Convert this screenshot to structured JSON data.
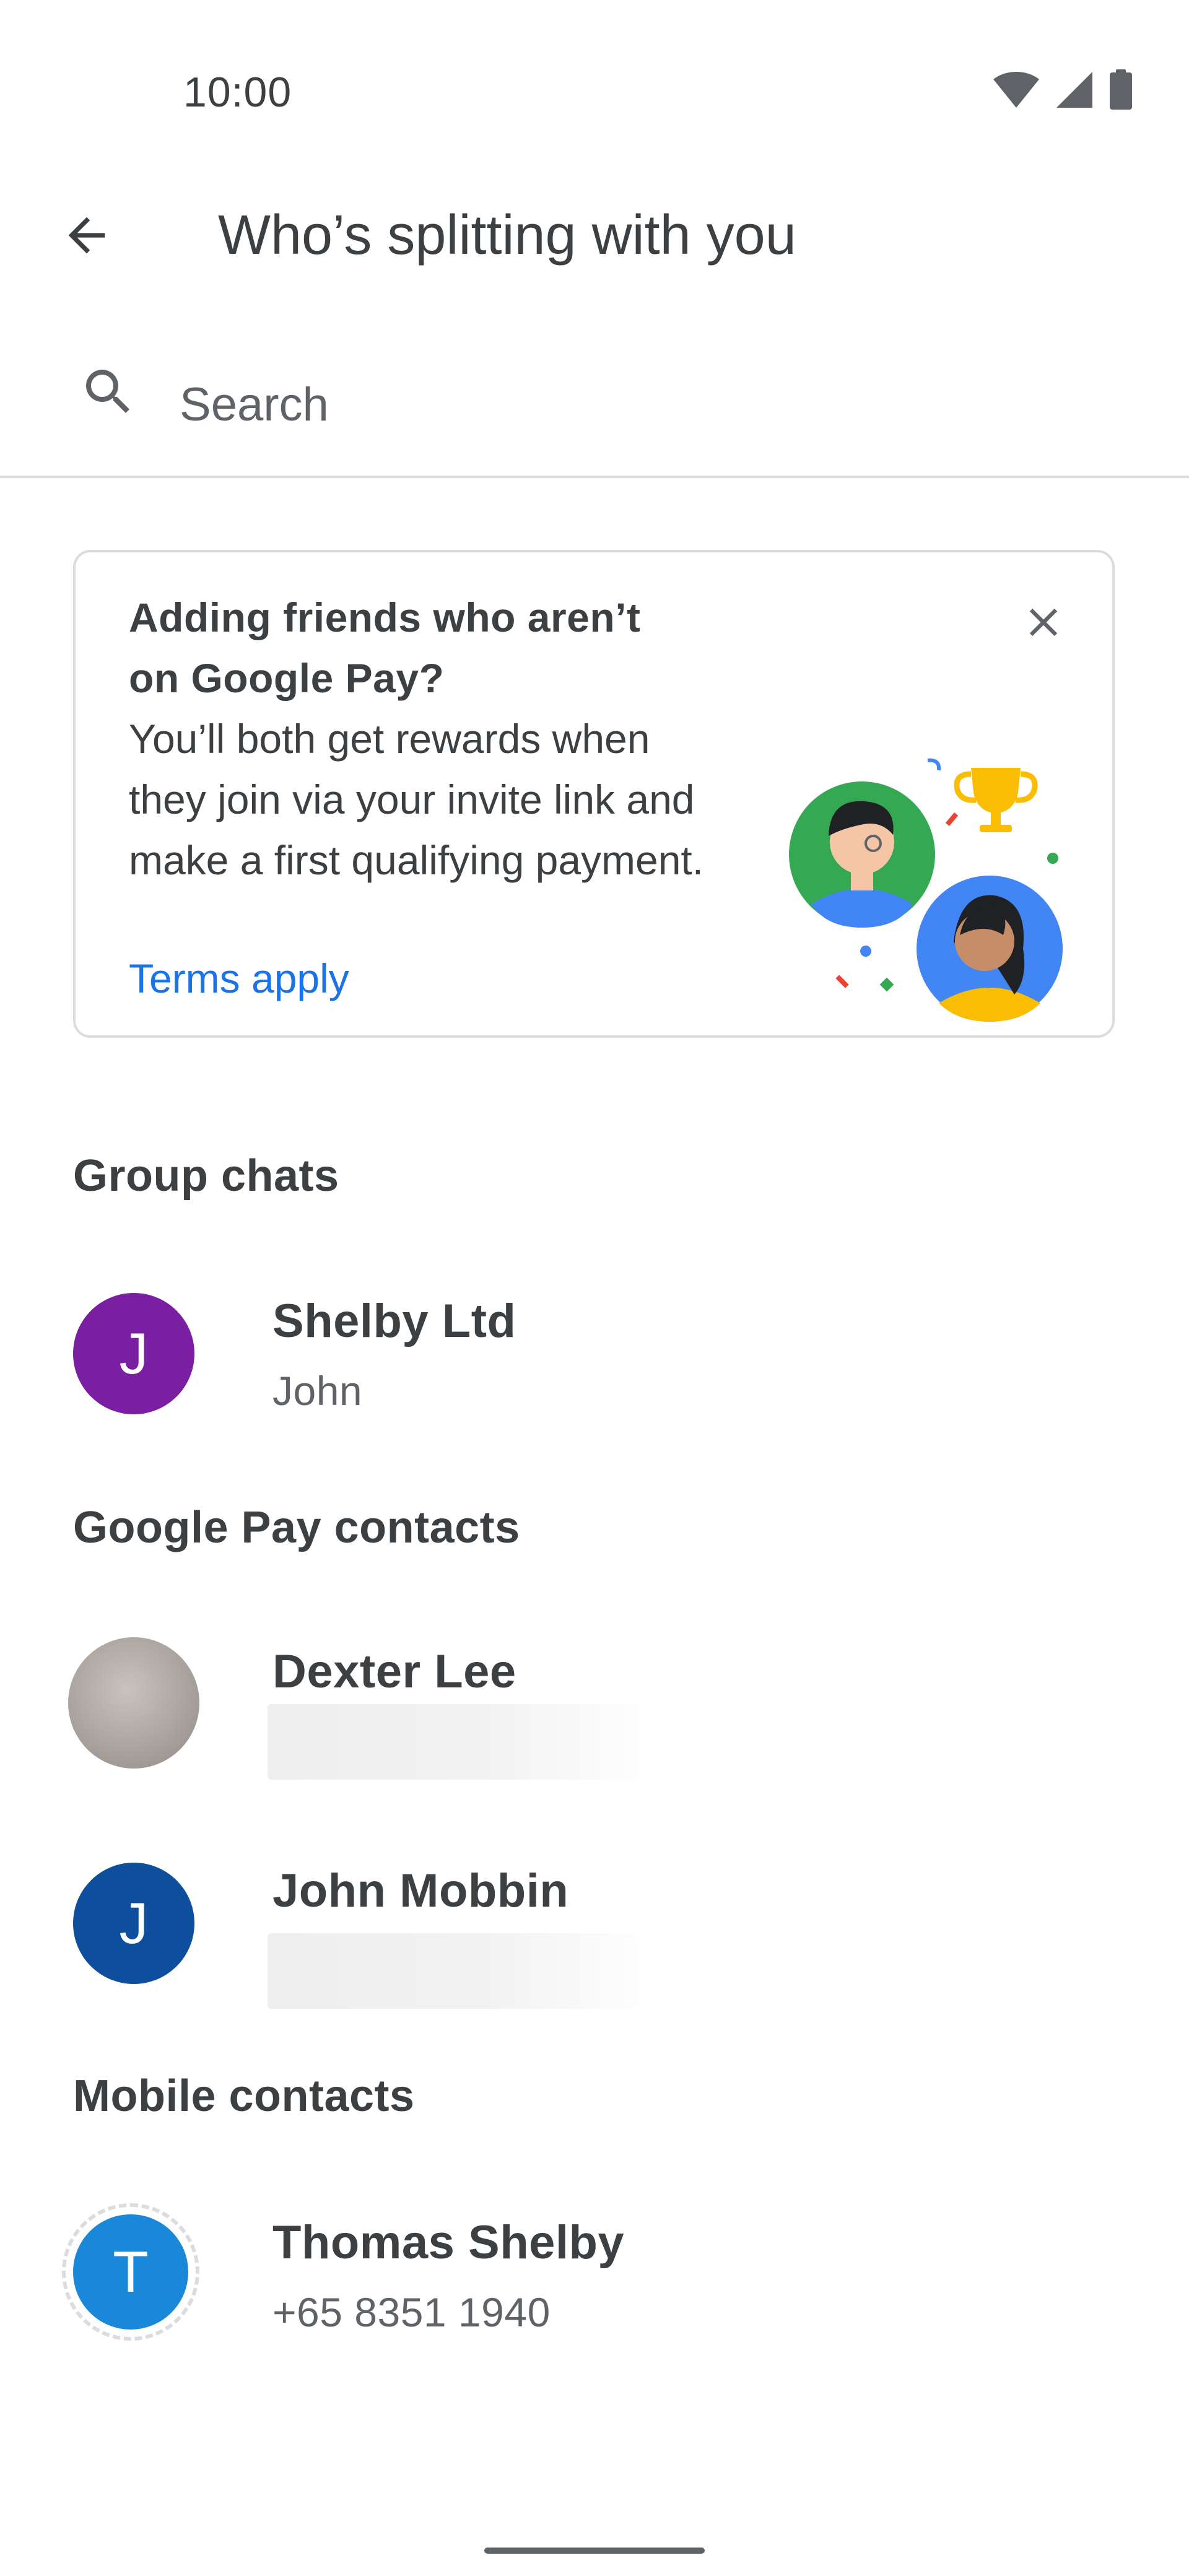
{
  "status_bar": {
    "time": "10:00",
    "icons": [
      "wifi-icon",
      "cellular-signal-icon",
      "battery-icon"
    ]
  },
  "app_bar": {
    "title": "Who’s splitting with you",
    "back_icon": "arrow-back-icon"
  },
  "search": {
    "placeholder": "Search",
    "value": ""
  },
  "promo": {
    "heading": "Adding friends who aren’t on Google Pay?",
    "body": "You’ll both get rewards when they join via your invite link and make a first qualifying payment.",
    "link": "Terms apply",
    "close_icon": "close-icon"
  },
  "sections": {
    "group_chats": {
      "header": "Group chats",
      "items": [
        {
          "initial": "J",
          "name": "Shelby Ltd",
          "subtitle": "John",
          "color": "#7b1fa2"
        }
      ]
    },
    "gpay_contacts": {
      "header": "Google Pay contacts",
      "items": [
        {
          "initial": "",
          "name": "Dexter Lee",
          "subtitle": "",
          "color": "#a39e9a"
        },
        {
          "initial": "J",
          "name": "John Mobbin",
          "subtitle": "",
          "color": "#0d4f9c"
        }
      ]
    },
    "mobile_contacts": {
      "header": "Mobile contacts",
      "items": [
        {
          "initial": "T",
          "name": "Thomas Shelby",
          "subtitle": "+65 8351 1940",
          "color": "#1a88d8"
        }
      ]
    }
  },
  "colors": {
    "link_blue": "#1a73e8",
    "divider": "#dadce0",
    "text_primary": "#3c4043",
    "text_secondary": "#5f6368"
  }
}
